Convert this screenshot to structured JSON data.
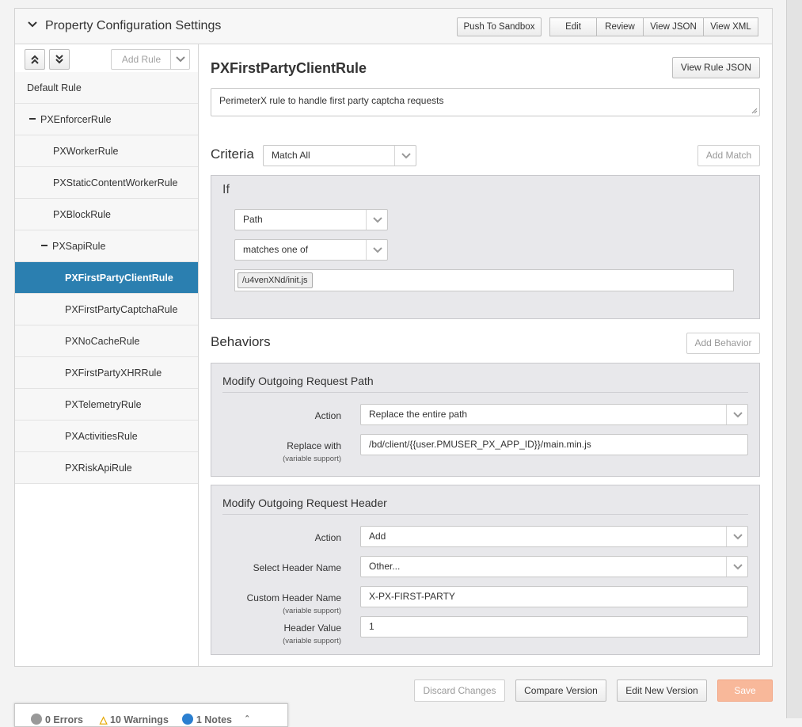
{
  "header": {
    "title": "Property Configuration Settings",
    "push_to_sandbox": "Push To Sandbox",
    "edit": "Edit",
    "review": "Review",
    "view_json": "View JSON",
    "view_xml": "View XML"
  },
  "sidebar": {
    "add_rule": "Add Rule",
    "items": [
      {
        "label": "Default Rule"
      },
      {
        "label": "PXEnforcerRule"
      },
      {
        "label": "PXWorkerRule"
      },
      {
        "label": "PXStaticContentWorkerRule"
      },
      {
        "label": "PXBlockRule"
      },
      {
        "label": "PXSapiRule"
      },
      {
        "label": "PXFirstPartyClientRule"
      },
      {
        "label": "PXFirstPartyCaptchaRule"
      },
      {
        "label": "PXNoCacheRule"
      },
      {
        "label": "PXFirstPartyXHRRule"
      },
      {
        "label": "PXTelemetryRule"
      },
      {
        "label": "PXActivitiesRule"
      },
      {
        "label": "PXRiskApiRule"
      }
    ]
  },
  "rule": {
    "title": "PXFirstPartyClientRule",
    "view_rule_json": "View Rule JSON",
    "comment": "PerimeterX rule to handle first party captcha requests"
  },
  "criteria": {
    "title": "Criteria",
    "match_mode": "Match All",
    "add_match": "Add Match",
    "if_label": "If",
    "field": "Path",
    "operator": "matches one of",
    "values": [
      "/u4venXNd/init.js"
    ]
  },
  "behaviors": {
    "title": "Behaviors",
    "add_behavior": "Add Behavior",
    "path": {
      "title": "Modify Outgoing Request Path",
      "action_label": "Action",
      "action_value": "Replace the entire path",
      "replace_label": "Replace with",
      "replace_sub": "(variable support)",
      "replace_value": "/bd/client/{{user.PMUSER_PX_APP_ID}}/main.min.js"
    },
    "header": {
      "title": "Modify Outgoing Request Header",
      "action_label": "Action",
      "action_value": "Add",
      "select_label": "Select Header Name",
      "select_value": "Other...",
      "custom_label": "Custom Header Name",
      "custom_sub": "(variable support)",
      "custom_value": "X-PX-FIRST-PARTY",
      "value_label": "Header Value",
      "value_sub": "(variable support)",
      "value_value": "1"
    }
  },
  "footer": {
    "discard": "Discard Changes",
    "compare": "Compare Version",
    "edit_new": "Edit New Version",
    "save": "Save"
  },
  "status": {
    "errors": "0 Errors",
    "warnings": "10 Warnings",
    "notes": "1 Notes"
  },
  "colors": {
    "selected": "#2b7fb0",
    "save": "#f8b89a",
    "panel_bg": "#e8e8eb"
  }
}
